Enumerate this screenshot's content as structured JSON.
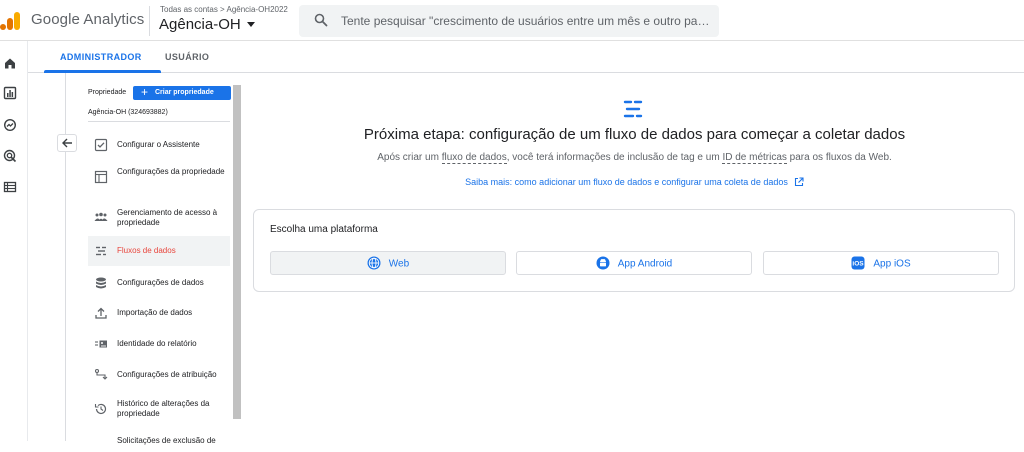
{
  "app": {
    "name": "Google Analytics",
    "account_crumb": "Todas as contas > Agência-OH2022",
    "property_name": "Agência-OH"
  },
  "search": {
    "placeholder": "Tente pesquisar \"crescimento de usuários entre um mês e outro para cad..."
  },
  "tabs": [
    {
      "label": "ADMINISTRADOR",
      "active": true
    },
    {
      "label": "USUÁRIO",
      "active": false
    }
  ],
  "admin": {
    "section_label": "Propriedade",
    "create_button": "Criar propriedade",
    "property_id": "Agência-OH (324693882)",
    "menu": [
      {
        "label": "Configurar o Assistente",
        "icon": "checkbox-icon"
      },
      {
        "label": "Configurações da propriedade",
        "icon": "window-icon"
      },
      {
        "label": "Gerenciamento de acesso à propriedade",
        "icon": "people-icon"
      },
      {
        "label": "Fluxos de dados",
        "icon": "data-streams-icon",
        "active": true
      },
      {
        "label": "Configurações de dados",
        "icon": "database-icon"
      },
      {
        "label": "Importação de dados",
        "icon": "upload-icon"
      },
      {
        "label": "Identidade do relatório",
        "icon": "report-identity-icon"
      },
      {
        "label": "Configurações de atribuição",
        "icon": "attribution-icon"
      },
      {
        "label": "Histórico de alterações da propriedade",
        "icon": "history-icon"
      },
      {
        "label": "Solicitações de exclusão de",
        "icon": "delete-request-icon"
      }
    ]
  },
  "main": {
    "title": "Próxima etapa: configuração de um fluxo de dados para começar a coletar dados",
    "subtitle": {
      "p1": "Após criar um ",
      "term1": "fluxo de dados",
      "p2": ", você terá informações de inclusão de tag e um ",
      "term2": "ID de métricas",
      "p3": " para os fluxos da Web."
    },
    "learn_more": "Saiba mais: como adicionar um fluxo de dados e configurar uma coleta de dados",
    "platform_card": {
      "title": "Escolha uma plataforma",
      "options": [
        {
          "label": "Web",
          "icon": "globe-icon",
          "selected": true
        },
        {
          "label": "App Android",
          "icon": "android-icon",
          "selected": false
        },
        {
          "label": "App iOS",
          "icon": "ios-icon",
          "selected": false
        }
      ]
    }
  },
  "colors": {
    "accent": "#1a73e8",
    "active_menu_text": "#e8453c",
    "logo_orange": "#f9ab00",
    "logo_dark_orange": "#e37400"
  }
}
